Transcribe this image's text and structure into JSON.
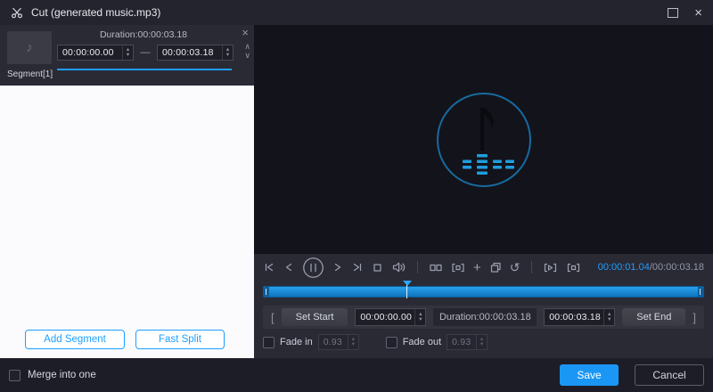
{
  "window": {
    "title": "Cut (generated music.mp3)"
  },
  "segment_panel": {
    "duration": "Duration:00:00:03.18",
    "start": "00:00:00.00",
    "dash": "—",
    "end": "00:00:03.18",
    "label": "Segment[1]",
    "add_segment": "Add Segment",
    "fast_split": "Fast Split"
  },
  "player": {
    "current_time": "00:00:01.04",
    "total_time": "/00:00:03.18",
    "progress_percent": 32.7
  },
  "trim": {
    "open_bracket": "[",
    "set_start": "Set Start",
    "start": "00:00:00.00",
    "duration": "Duration:00:00:03.18",
    "end": "00:00:03.18",
    "set_end": "Set End",
    "close_bracket": "]"
  },
  "fade": {
    "fade_in": "Fade in",
    "fade_in_value": "0.93",
    "fade_out": "Fade out",
    "fade_out_value": "0.93"
  },
  "footer": {
    "merge": "Merge into one",
    "save": "Save",
    "cancel": "Cancel"
  },
  "icons": {
    "close": "×",
    "chevron_up": "∧",
    "chevron_down": "∨",
    "spin_up": "▴",
    "spin_down": "▾",
    "plus": "+",
    "reset": "↺",
    "note": "♪"
  },
  "colors": {
    "accent": "#1e9fff",
    "save_button": "#1a97f5",
    "timeline_fill": "#1787d6"
  }
}
